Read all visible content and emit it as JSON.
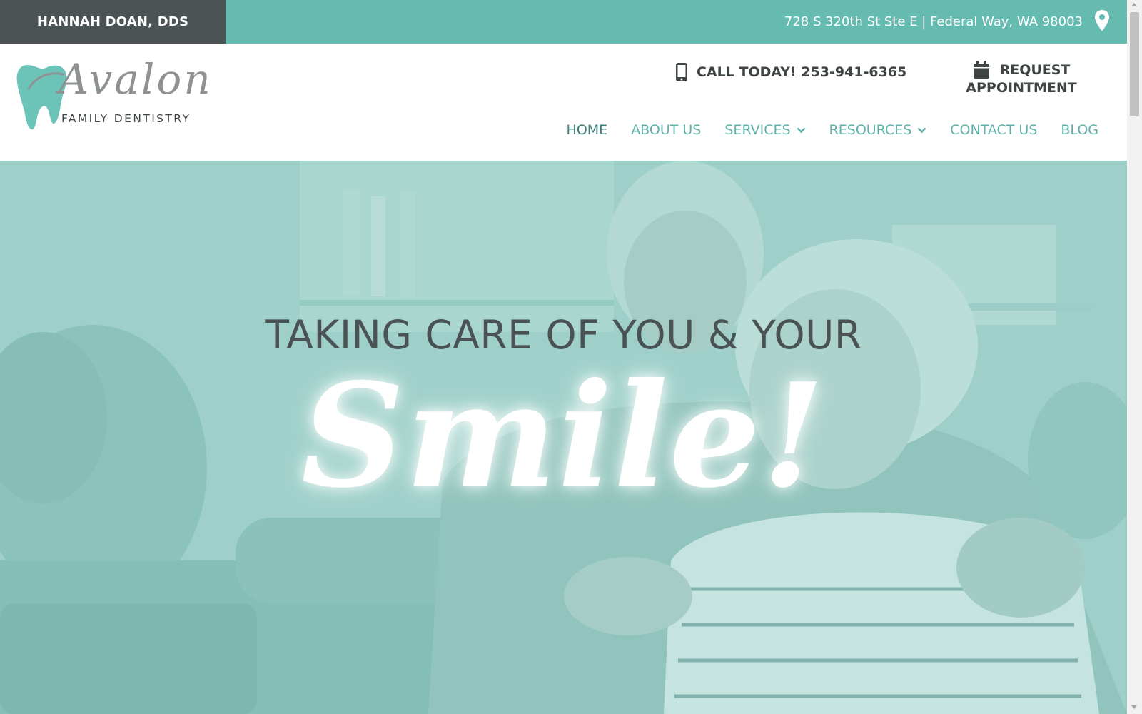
{
  "topbar": {
    "doctor_name": "HANNAH DOAN, DDS",
    "address": "728 S 320th St Ste E | Federal Way, WA 98003",
    "address_icon": "map-pin-icon",
    "color": "#66bbb1",
    "doctor_box_color": "#4c5354"
  },
  "logo": {
    "script_text": "Avalon",
    "subtitle": "FAMILY DENTISTRY",
    "icon": "tooth-icon",
    "accent_color": "#6cc3b8"
  },
  "header": {
    "call_label": "CALL TODAY! 253-941-6365",
    "call_icon": "mobile-phone-icon",
    "request_line1": "REQUEST",
    "request_line2": "APPOINTMENT",
    "request_icon": "calendar-icon"
  },
  "nav": {
    "items": [
      {
        "label": "HOME",
        "active": true
      },
      {
        "label": "ABOUT US"
      },
      {
        "label": "SERVICES",
        "dropdown": true
      },
      {
        "label": "RESOURCES",
        "dropdown": true
      },
      {
        "label": "CONTACT US"
      },
      {
        "label": "BLOG"
      }
    ],
    "color": "#5fb1a8",
    "active_color": "#3e7f79"
  },
  "hero": {
    "headline": "TAKING CARE OF YOU & YOUR",
    "script": "Smile!",
    "overlay_color": "#9cd0c9"
  }
}
